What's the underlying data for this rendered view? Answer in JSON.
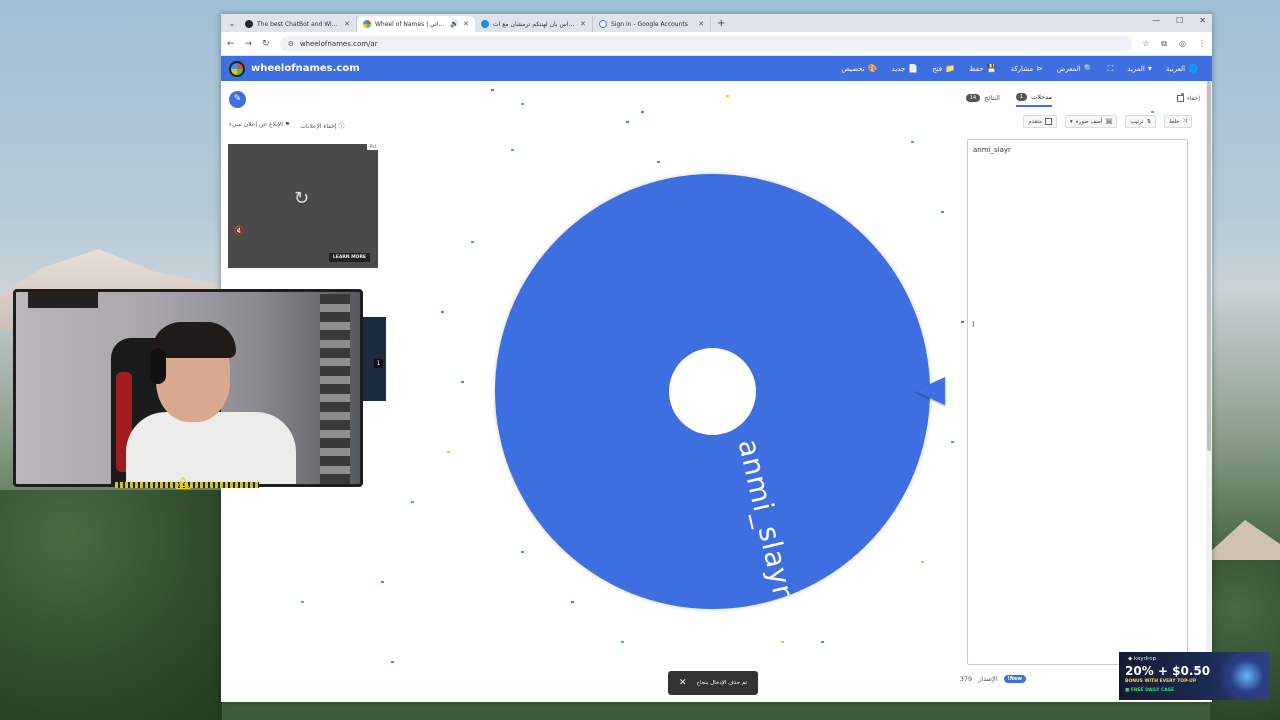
{
  "browser": {
    "tabs": [
      {
        "label": "The best ChatBot and Widgets",
        "icon": "github-icon"
      },
      {
        "label": "Wheel of Names | العشوائي",
        "icon": "wheel-icon",
        "active": true
      },
      {
        "label": "ميداس بان لهنتكم ترمشان مع آت",
        "icon": "edge-icon"
      },
      {
        "label": "Sign in - Google Accounts",
        "icon": "google-icon"
      }
    ],
    "url": "wheelofnames.com/ar"
  },
  "site": {
    "brand": "wheelofnames.com",
    "menu": [
      {
        "label": "العربية",
        "icon": "globe-icon"
      },
      {
        "label": "المزيد",
        "icon": "caret-down-icon"
      },
      {
        "label": "",
        "icon": "fullscreen-icon"
      },
      {
        "label": "المعرض",
        "icon": "search-icon"
      },
      {
        "label": "مشاركة",
        "icon": "share-icon"
      },
      {
        "label": "حفظ",
        "icon": "save-icon"
      },
      {
        "label": "فتح",
        "icon": "folder-icon"
      },
      {
        "label": "جديد",
        "icon": "file-icon"
      },
      {
        "label": "تخصيص",
        "icon": "palette-icon"
      }
    ]
  },
  "left": {
    "ad_links": [
      "إخفاء الإعلانات",
      "الإبلاغ عن إعلان سيء"
    ],
    "ad_cta": "LEARN MORE",
    "ad_tag": "Ad",
    "ad2_count": "1"
  },
  "wheel": {
    "entries": [
      "anmi_slayr"
    ],
    "color": "#3e6fe0"
  },
  "panel": {
    "tabs": [
      {
        "label": "مدخلات",
        "count": "1"
      },
      {
        "label": "النتائج",
        "count": "14"
      }
    ],
    "hide_label": "إخفاء",
    "toolbar": [
      {
        "label": "خلط",
        "icon": "shuffle-icon"
      },
      {
        "label": "ترتيب",
        "icon": "sort-icon"
      },
      {
        "label": "أضف صورة",
        "icon": "image-icon"
      },
      {
        "label": "متقدم",
        "icon": "checkbox"
      }
    ],
    "entries_text": "anmi_slayr",
    "version_label": "الإصدار",
    "version_number": "379",
    "new_badge": "New!"
  },
  "toast": {
    "message": "تم حذف الإدخال بنجاح"
  },
  "keydrop": {
    "brand": "◆ keydrop",
    "headline": "20% + $0.50",
    "subline": "BONUS WITH EVERY TOP-UP",
    "cta": "■ FREE DAILY CASE"
  }
}
